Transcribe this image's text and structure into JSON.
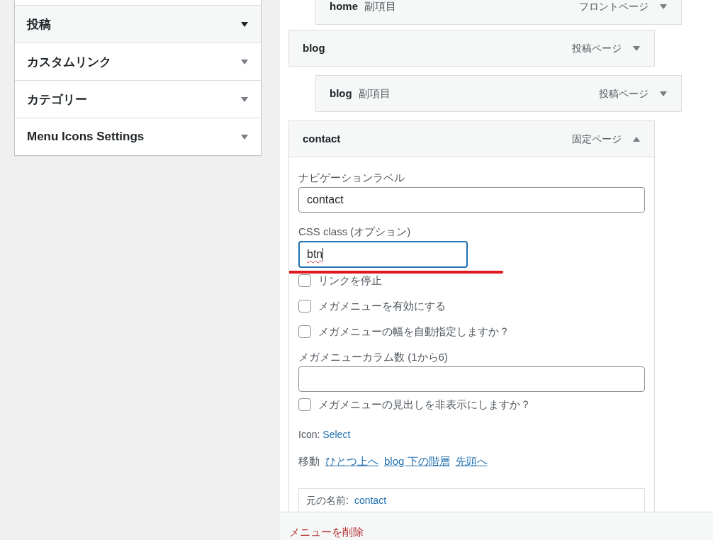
{
  "sidebar": {
    "sections": [
      {
        "title": "投稿",
        "selected": true
      },
      {
        "title": "カスタムリンク",
        "selected": false
      },
      {
        "title": "カテゴリー",
        "selected": false
      },
      {
        "title": "Menu Icons Settings",
        "selected": false
      }
    ]
  },
  "menu_items": [
    {
      "children": [
        {
          "title": "home",
          "sub_label": "副項目",
          "type": "フロントページ",
          "expanded": false
        }
      ]
    },
    {
      "title": "blog",
      "type": "投稿ページ",
      "expanded": false,
      "children": [
        {
          "title": "blog",
          "sub_label": "副項目",
          "type": "投稿ページ",
          "expanded": false
        }
      ]
    },
    {
      "title": "contact",
      "type": "固定ページ",
      "expanded": true,
      "settings": [
        {
          "kind": "text",
          "label": "ナビゲーションラベル",
          "value": "contact",
          "focused": false
        },
        {
          "kind": "short_text",
          "label": "CSS class (オプション)",
          "value": "btn",
          "focused": true,
          "highlighted": true,
          "misspelled": true
        },
        {
          "kind": "checkbox",
          "label": "リンクを停止",
          "checked": false
        },
        {
          "kind": "checkbox",
          "label": "メガメニューを有効にする",
          "checked": false
        },
        {
          "kind": "checkbox",
          "label": "メガメニューの幅を自動指定しますか？",
          "checked": false
        },
        {
          "kind": "text",
          "label": "メガメニューカラム数 (1から6)",
          "focused": false
        },
        {
          "kind": "checkbox",
          "label": "メガメニューの見出しを非表示にしますか？",
          "checked": false
        },
        {
          "kind": "icon",
          "label": "Icon:",
          "link": "Select"
        },
        {
          "kind": "move",
          "label": "移動",
          "links": [
            "ひとつ上へ",
            "blog 下の階層",
            "先頭へ"
          ]
        },
        {
          "kind": "original",
          "label": "元の名前:",
          "link": "contact"
        }
      ]
    }
  ],
  "footer": {
    "delete_link": "メニューを削除"
  }
}
